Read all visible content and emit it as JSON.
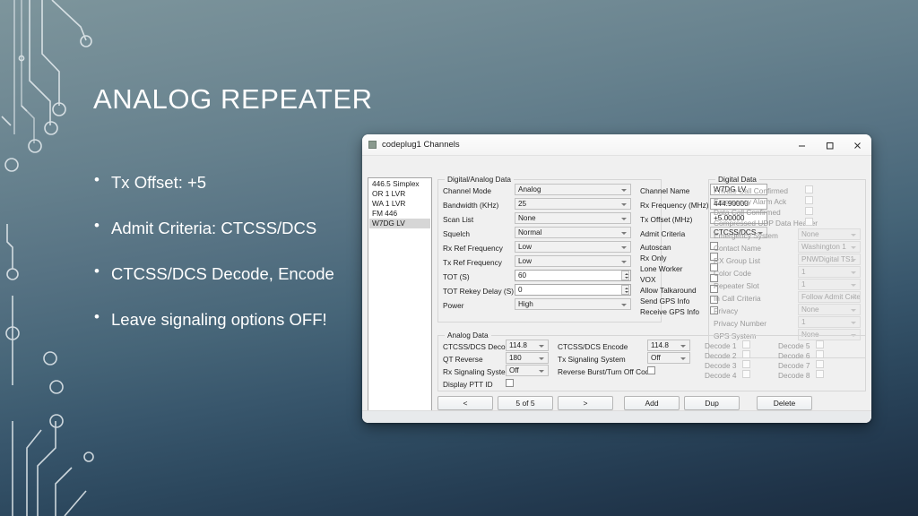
{
  "slide": {
    "title": "ANALOG REPEATER",
    "bullets": [
      "Tx Offset: +5",
      "Admit Criteria: CTCSS/DCS",
      "CTCSS/DCS Decode, Encode",
      "Leave signaling options OFF!"
    ],
    "colors": {
      "background_top": "#7d959c",
      "background_bottom": "#1b2c3f",
      "text": "#ffffff"
    }
  },
  "window": {
    "title": "codeplug1 Channels",
    "controls": {
      "minimize": "–",
      "maximize": "□",
      "close": "✕"
    },
    "channel_list": {
      "items": [
        "446.5 Simplex",
        "OR 1 LVR",
        "WA 1 LVR",
        "FM 446",
        "W7DG LV"
      ],
      "selected": "W7DG LV"
    },
    "digital_analog_data": {
      "legend": "Digital/Analog Data",
      "fields": [
        {
          "label": "Channel Mode",
          "value": "Analog"
        },
        {
          "label": "Bandwidth (KHz)",
          "value": "25"
        },
        {
          "label": "Scan List",
          "value": "None"
        },
        {
          "label": "Squelch",
          "value": "Normal"
        },
        {
          "label": "Rx Ref Frequency",
          "value": "Low"
        },
        {
          "label": "Tx Ref Frequency",
          "value": "Low"
        },
        {
          "label": "TOT (S)",
          "value": "60"
        },
        {
          "label": "TOT Rekey Delay (S)",
          "value": "0"
        },
        {
          "label": "Power",
          "value": "High"
        }
      ],
      "right_fields": [
        {
          "label": "Channel Name",
          "value": "W7DG LV"
        },
        {
          "label": "Rx Frequency (MHz)",
          "value": "444.90000"
        },
        {
          "label": "Tx Offset (MHz)",
          "value": "+5.00000"
        },
        {
          "label": "Admit Criteria",
          "value": "CTCSS/DCS"
        }
      ],
      "checkboxes": [
        {
          "label": "Autoscan",
          "checked": false
        },
        {
          "label": "Rx Only",
          "checked": false
        },
        {
          "label": "Lone Worker",
          "checked": false
        },
        {
          "label": "VOX",
          "checked": false
        },
        {
          "label": "Allow Talkaround",
          "checked": false
        },
        {
          "label": "Send GPS Info",
          "checked": false
        },
        {
          "label": "Receive GPS Info",
          "checked": false
        }
      ]
    },
    "digital_data": {
      "legend": "Digital Data",
      "checkboxes": [
        {
          "label": "Private Call Confirmed",
          "checked": false
        },
        {
          "label": "Emergency Alarm Ack",
          "checked": false
        },
        {
          "label": "Data Call Confirmed",
          "checked": false
        },
        {
          "label": "Compressed UDP Data Header",
          "checked": false
        }
      ],
      "fields": [
        {
          "label": "Emergency System",
          "value": "None"
        },
        {
          "label": "Contact Name",
          "value": "Washington 1"
        },
        {
          "label": "RX Group List",
          "value": "PNWDigital TS1"
        },
        {
          "label": "Color Code",
          "value": "1"
        },
        {
          "label": "Repeater Slot",
          "value": "1"
        },
        {
          "label": "In Call Criteria",
          "value": "Follow Admit Criteria"
        },
        {
          "label": "Privacy",
          "value": "None"
        },
        {
          "label": "Privacy Number",
          "value": "1"
        },
        {
          "label": "GPS System",
          "value": "None"
        }
      ]
    },
    "analog_data": {
      "legend": "Analog Data",
      "fields_left": [
        {
          "label": "CTCSS/DCS Decode",
          "value": "114.8"
        },
        {
          "label": "QT Reverse",
          "value": "180"
        },
        {
          "label": "Rx Signaling System",
          "value": "Off"
        }
      ],
      "display_ptt_id": {
        "label": "Display PTT ID",
        "checked": false
      },
      "fields_right": [
        {
          "label": "CTCSS/DCS Encode",
          "value": "114.8"
        },
        {
          "label": "Tx Signaling System",
          "value": "Off"
        }
      ],
      "reverse_burst": {
        "label": "Reverse Burst/Turn Off Code",
        "checked": false
      },
      "decodes_col1": [
        {
          "label": "Decode 1",
          "checked": false
        },
        {
          "label": "Decode 2",
          "checked": false
        },
        {
          "label": "Decode 3",
          "checked": false
        },
        {
          "label": "Decode 4",
          "checked": false
        }
      ],
      "decodes_col2": [
        {
          "label": "Decode 5",
          "checked": false
        },
        {
          "label": "Decode 6",
          "checked": false
        },
        {
          "label": "Decode 7",
          "checked": false
        },
        {
          "label": "Decode 8",
          "checked": false
        }
      ]
    },
    "footer_buttons": {
      "prev": "<",
      "counter": "5 of 5",
      "next": ">",
      "add": "Add",
      "dup": "Dup",
      "delete": "Delete"
    }
  }
}
